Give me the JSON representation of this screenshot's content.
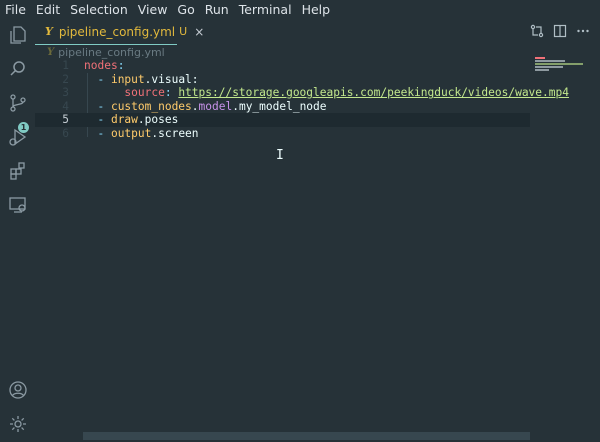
{
  "menu": [
    "File",
    "Edit",
    "Selection",
    "View",
    "Go",
    "Run",
    "Terminal",
    "Help"
  ],
  "activity": {
    "items": [
      "explorer-icon",
      "search-icon",
      "source-control-icon",
      "run-debug-icon",
      "extensions-icon",
      "remote-explorer-icon"
    ],
    "badge": "1",
    "bottom": [
      "account-icon",
      "settings-gear-icon"
    ]
  },
  "tab": {
    "file_icon": "Y",
    "filename": "pipeline_config.yml",
    "modified": "U",
    "close": "×"
  },
  "tab_actions": [
    "compare-changes-icon",
    "split-editor-icon",
    "more-actions-icon"
  ],
  "breadcrumb": {
    "file_icon": "Y",
    "filename": "pipeline_config.yml"
  },
  "code": {
    "lines": [
      {
        "num": "1",
        "parts": [
          {
            "t": "nodes",
            "c": "k"
          },
          {
            "t": ":",
            "c": "punct"
          }
        ]
      },
      {
        "num": "2",
        "parts": [
          {
            "t": "  - ",
            "c": "punct"
          },
          {
            "t": "input",
            "c": "fn"
          },
          {
            "t": ".visual:",
            "c": "plain"
          }
        ]
      },
      {
        "num": "3",
        "parts": [
          {
            "t": "      source",
            "c": "k"
          },
          {
            "t": ": ",
            "c": "punct"
          },
          {
            "t": "https://storage.googleapis.com/peekingduck/videos/wave.mp4",
            "c": "url"
          }
        ]
      },
      {
        "num": "4",
        "parts": [
          {
            "t": "  - ",
            "c": "punct"
          },
          {
            "t": "custom_nodes",
            "c": "fn"
          },
          {
            "t": ".",
            "c": "plain"
          },
          {
            "t": "model",
            "c": "k2"
          },
          {
            "t": ".my_model_node",
            "c": "plain"
          }
        ]
      },
      {
        "num": "5",
        "parts": [
          {
            "t": "  - ",
            "c": "punct"
          },
          {
            "t": "draw",
            "c": "fn"
          },
          {
            "t": ".poses",
            "c": "plain"
          }
        ]
      },
      {
        "num": "6",
        "parts": [
          {
            "t": "  - ",
            "c": "punct"
          },
          {
            "t": "output",
            "c": "fn"
          },
          {
            "t": ".screen",
            "c": "plain"
          }
        ]
      }
    ],
    "active_line": "5"
  },
  "cursor": "I",
  "colors": {
    "background": "#263238",
    "accent": "#80cbc4",
    "yaml_key": "#f07178",
    "string": "#c3e88d",
    "yellow": "#ffcb6b"
  }
}
